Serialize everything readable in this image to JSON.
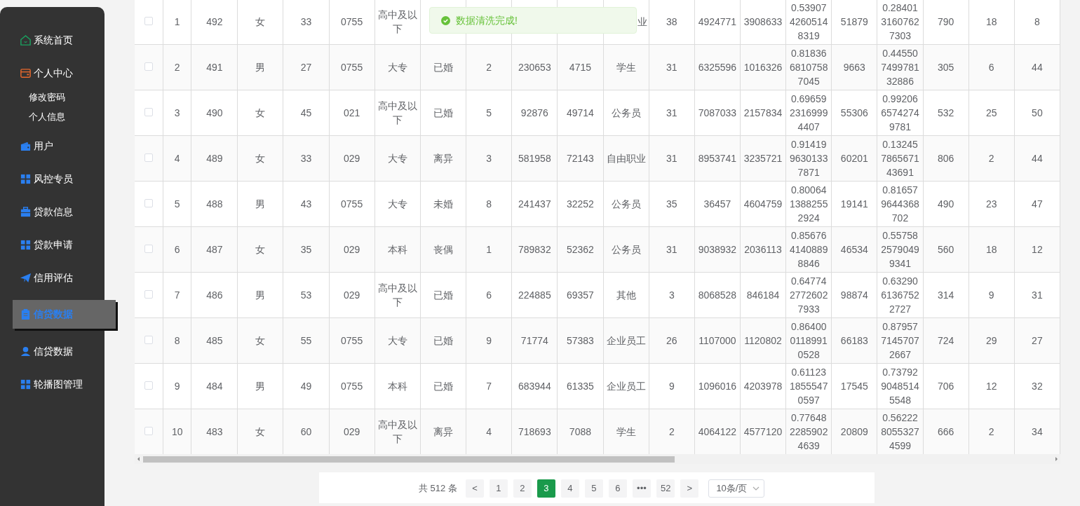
{
  "sidebar": {
    "items": [
      {
        "label": "系统首页",
        "selected": false
      },
      {
        "label": "个人中心",
        "selected": false,
        "children": [
          {
            "label": "修改密码",
            "selected": false
          },
          {
            "label": "个人信息",
            "selected": false
          }
        ]
      },
      {
        "label": "用户",
        "selected": false
      },
      {
        "label": "风控专员",
        "selected": false
      },
      {
        "label": "贷款信息",
        "selected": false
      },
      {
        "label": "贷款申请",
        "selected": false
      },
      {
        "label": "信用评估",
        "selected": false
      },
      {
        "label": "信贷数据",
        "selected": true
      },
      {
        "label": "信贷数据",
        "selected": false
      },
      {
        "label": "轮播图管理",
        "selected": false
      }
    ]
  },
  "toast": {
    "kind": "success",
    "message": "数据清洗完成!"
  },
  "table": {
    "rows": [
      {
        "checked": false,
        "cells": [
          "1",
          "492",
          "女",
          "33",
          "0755",
          "高中及以下",
          null,
          null,
          null,
          null,
          {
            "text": "业",
            "kind": "cut_left"
          },
          "38",
          "4924771",
          "3908633",
          "0.5390742605148319",
          "51879",
          "0.2840131607627303",
          "790",
          "18",
          "8"
        ]
      },
      {
        "checked": false,
        "cells": [
          "2",
          "491",
          "男",
          "27",
          "0755",
          "大专",
          "已婚",
          "2",
          "230653",
          "4715",
          "学生",
          "31",
          "6325596",
          "1016326",
          "0.8183668107587045",
          "9663",
          "0.44550749978132886",
          "305",
          "6",
          "44"
        ]
      },
      {
        "checked": false,
        "cells": [
          "3",
          "490",
          "女",
          "45",
          "021",
          "高中及以下",
          "已婚",
          "5",
          "92876",
          "49714",
          "公务员",
          "31",
          "7087033",
          "2157834",
          "0.6965923169994407",
          "55306",
          "0.9920665742749781",
          "532",
          "25",
          "50"
        ]
      },
      {
        "checked": false,
        "cells": [
          "4",
          "489",
          "女",
          "33",
          "029",
          "大专",
          "离异",
          "3",
          "581958",
          "72143",
          "自由职业",
          "31",
          "8953741",
          "3235721",
          "0.9141996301337871",
          "60201",
          "0.13245786567143691",
          "806",
          "2",
          "44"
        ]
      },
      {
        "checked": false,
        "cells": [
          "5",
          "488",
          "男",
          "43",
          "0755",
          "大专",
          "未婚",
          "8",
          "241437",
          "32252",
          "公务员",
          "35",
          "36457",
          "4604759",
          "0.8006413882552924",
          "19141",
          "0.816579644368702",
          "490",
          "23",
          "47"
        ]
      },
      {
        "checked": false,
        "cells": [
          "6",
          "487",
          "女",
          "35",
          "029",
          "本科",
          "丧偶",
          "1",
          "789832",
          "52362",
          "公务员",
          "31",
          "9038932",
          "2036113",
          "0.8567641408898846",
          "46534",
          "0.5575825790499341",
          "560",
          "18",
          "12"
        ]
      },
      {
        "checked": false,
        "cells": [
          "7",
          "486",
          "男",
          "53",
          "029",
          "高中及以下",
          "已婚",
          "6",
          "224885",
          "69357",
          "其他",
          "3",
          "8068528",
          "846184",
          "0.6477427726027933",
          "98874",
          "0.6329061367522727",
          "314",
          "9",
          "31"
        ]
      },
      {
        "checked": false,
        "cells": [
          "8",
          "485",
          "女",
          "55",
          "0755",
          "大专",
          "已婚",
          "9",
          "71774",
          "57383",
          "企业员工",
          "26",
          "1107000",
          "1120802",
          "0.8640001189910528",
          "66183",
          "0.8795771457072667",
          "724",
          "29",
          "27"
        ]
      },
      {
        "checked": false,
        "cells": [
          "9",
          "484",
          "男",
          "49",
          "0755",
          "本科",
          "已婚",
          "7",
          "683944",
          "61335",
          "企业员工",
          "9",
          "1096016",
          "4203978",
          "0.6112318555470597",
          "17545",
          "0.7379290485145548",
          "706",
          "12",
          "32"
        ]
      },
      {
        "checked": false,
        "cells": [
          "10",
          "483",
          "女",
          "60",
          "029",
          "高中及以下",
          "离异",
          "4",
          "718693",
          "7088",
          "学生",
          "2",
          "4064122",
          "4577120",
          "0.7764822859024639",
          "20809",
          "0.5622280553274599",
          "666",
          "2",
          "34"
        ]
      }
    ]
  },
  "pagination": {
    "total": "共 512 条",
    "prev": "<",
    "pages": [
      {
        "label": "1",
        "selected": false
      },
      {
        "label": "2",
        "selected": false
      },
      {
        "label": "3",
        "selected": true
      },
      {
        "label": "4",
        "selected": false
      },
      {
        "label": "5",
        "selected": false
      },
      {
        "label": "6",
        "selected": false
      },
      {
        "label": "•••",
        "selected": false
      },
      {
        "label": "52",
        "selected": false
      }
    ],
    "next": ">",
    "page_size": "10条/页"
  }
}
